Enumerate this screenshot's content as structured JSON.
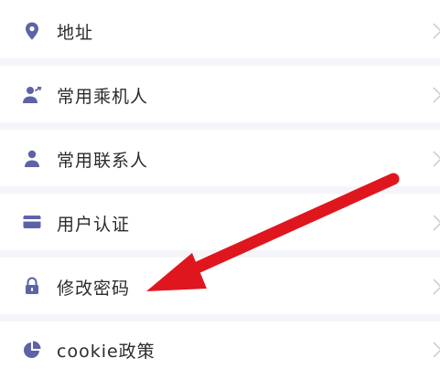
{
  "menu": {
    "items": [
      {
        "label": "地址",
        "icon": "location-pin-icon"
      },
      {
        "label": "常用乘机人",
        "icon": "passenger-icon"
      },
      {
        "label": "常用联系人",
        "icon": "contact-person-icon"
      },
      {
        "label": "用户认证",
        "icon": "card-icon"
      },
      {
        "label": "修改密码",
        "icon": "lock-icon"
      },
      {
        "label": "cookie政策",
        "icon": "pie-chart-icon"
      }
    ]
  },
  "colors": {
    "icon": "#5d63a8",
    "text": "#2b2b2b",
    "row_background": "#ffffff",
    "page_background": "#f4f5f9",
    "chevron": "#cfcfd6",
    "arrow": "#e0161f"
  }
}
